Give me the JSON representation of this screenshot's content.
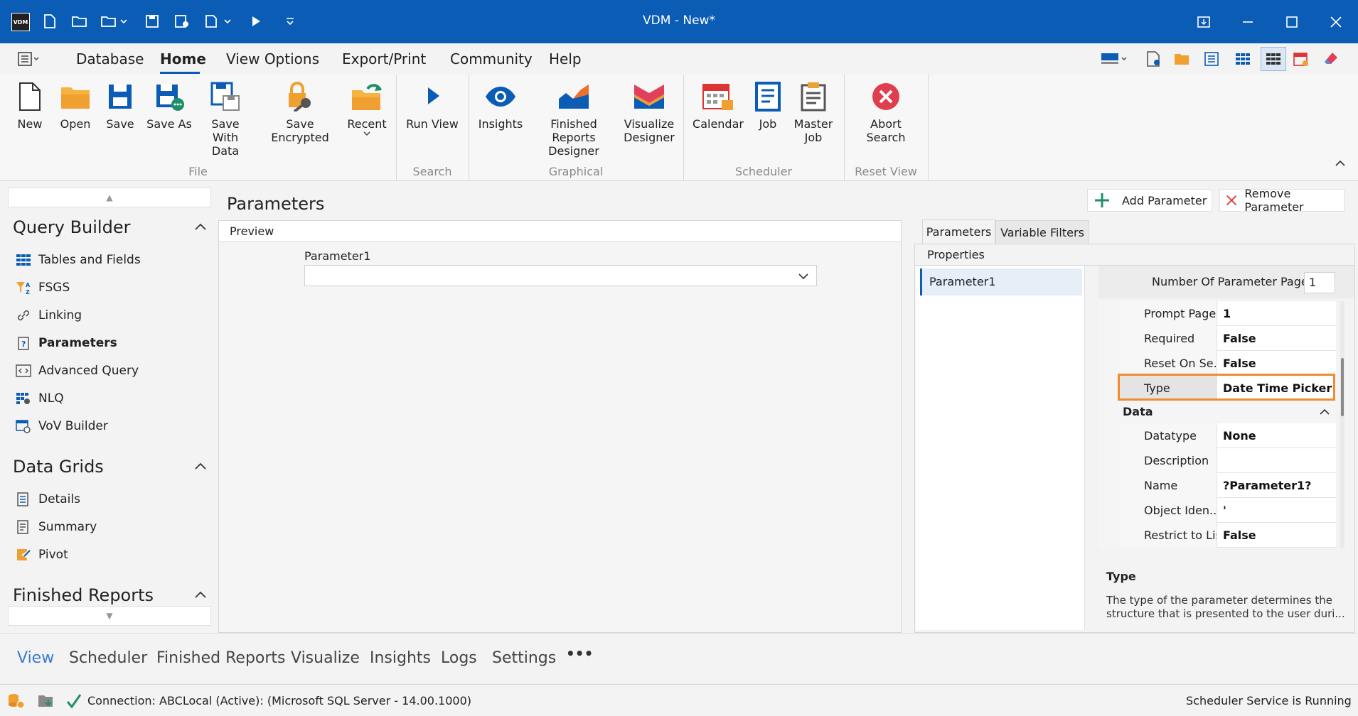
{
  "app": {
    "title": "VDM - New*",
    "logo_text": "VDM"
  },
  "menu": {
    "items": [
      "Database",
      "Home",
      "View Options",
      "Export/Print",
      "Community",
      "Help"
    ],
    "active": "Home"
  },
  "ribbon": {
    "buttons": {
      "new": "New",
      "open": "Open",
      "save": "Save",
      "save_as": "Save As",
      "save_with_data_1": "Save With",
      "save_with_data_2": "Data",
      "save_encrypted": "Save Encrypted",
      "recent": "Recent",
      "run_view": "Run View",
      "insights": "Insights",
      "finished_reports_1": "Finished Reports",
      "finished_reports_2": "Designer",
      "visualize_1": "Visualize",
      "visualize_2": "Designer",
      "calendar": "Calendar",
      "job": "Job",
      "master_job_1": "Master",
      "master_job_2": "Job",
      "abort_1": "Abort",
      "abort_2": "Search"
    },
    "groups": {
      "file": "File",
      "search": "Search",
      "graphical": "Graphical",
      "scheduler": "Scheduler",
      "reset_view": "Reset View"
    }
  },
  "sidebar": {
    "query_builder": {
      "title": "Query Builder",
      "items": [
        "Tables and Fields",
        "FSGS",
        "Linking",
        "Parameters",
        "Advanced Query",
        "NLQ",
        "VoV Builder"
      ],
      "active": "Parameters"
    },
    "data_grids": {
      "title": "Data Grids",
      "items": [
        "Details",
        "Summary",
        "Pivot"
      ]
    },
    "finished_reports": {
      "title": "Finished Reports"
    }
  },
  "page": {
    "title": "Parameters",
    "add_parameter": "Add Parameter",
    "remove_parameter": "Remove Parameter",
    "preview_label": "Preview",
    "preview_param_label": "Parameter1",
    "preview_param_value": ""
  },
  "right": {
    "tabs": [
      "Parameters",
      "Variable Filters"
    ],
    "active_tab": "Parameters",
    "properties_label": "Properties",
    "parameter_list": [
      "Parameter1"
    ],
    "num_pages_label": "Number Of Parameter Pages",
    "num_pages_value": "1",
    "rows_top": [
      {
        "key": "Prompt Page",
        "value": "1"
      },
      {
        "key": "Required",
        "value": "False"
      },
      {
        "key": "Reset On Se...",
        "value": "False"
      },
      {
        "key": "Type",
        "value": "Date Time Picker"
      }
    ],
    "data_section": "Data",
    "rows_data": [
      {
        "key": "Datatype",
        "value": "None"
      },
      {
        "key": "Description",
        "value": ""
      },
      {
        "key": "Name",
        "value": "?Parameter1?"
      },
      {
        "key": "Object Iden...",
        "value": "'"
      },
      {
        "key": "Restrict to List",
        "value": "False"
      }
    ],
    "desc_title": "Type",
    "desc_text_1": "The type of the parameter determines the",
    "desc_text_2": "structure that is presented to the user duri...",
    "highlight_color": "#f28a2e"
  },
  "bottom_tabs": [
    "View",
    "Scheduler",
    "Finished Reports",
    "Visualize",
    "Insights",
    "Logs",
    "Settings"
  ],
  "bottom_active": "View",
  "more": "•••",
  "status": {
    "connection": "Connection: ABCLocal (Active): (Microsoft SQL Server - 14.00.1000)",
    "scheduler": "Scheduler Service is Running"
  }
}
